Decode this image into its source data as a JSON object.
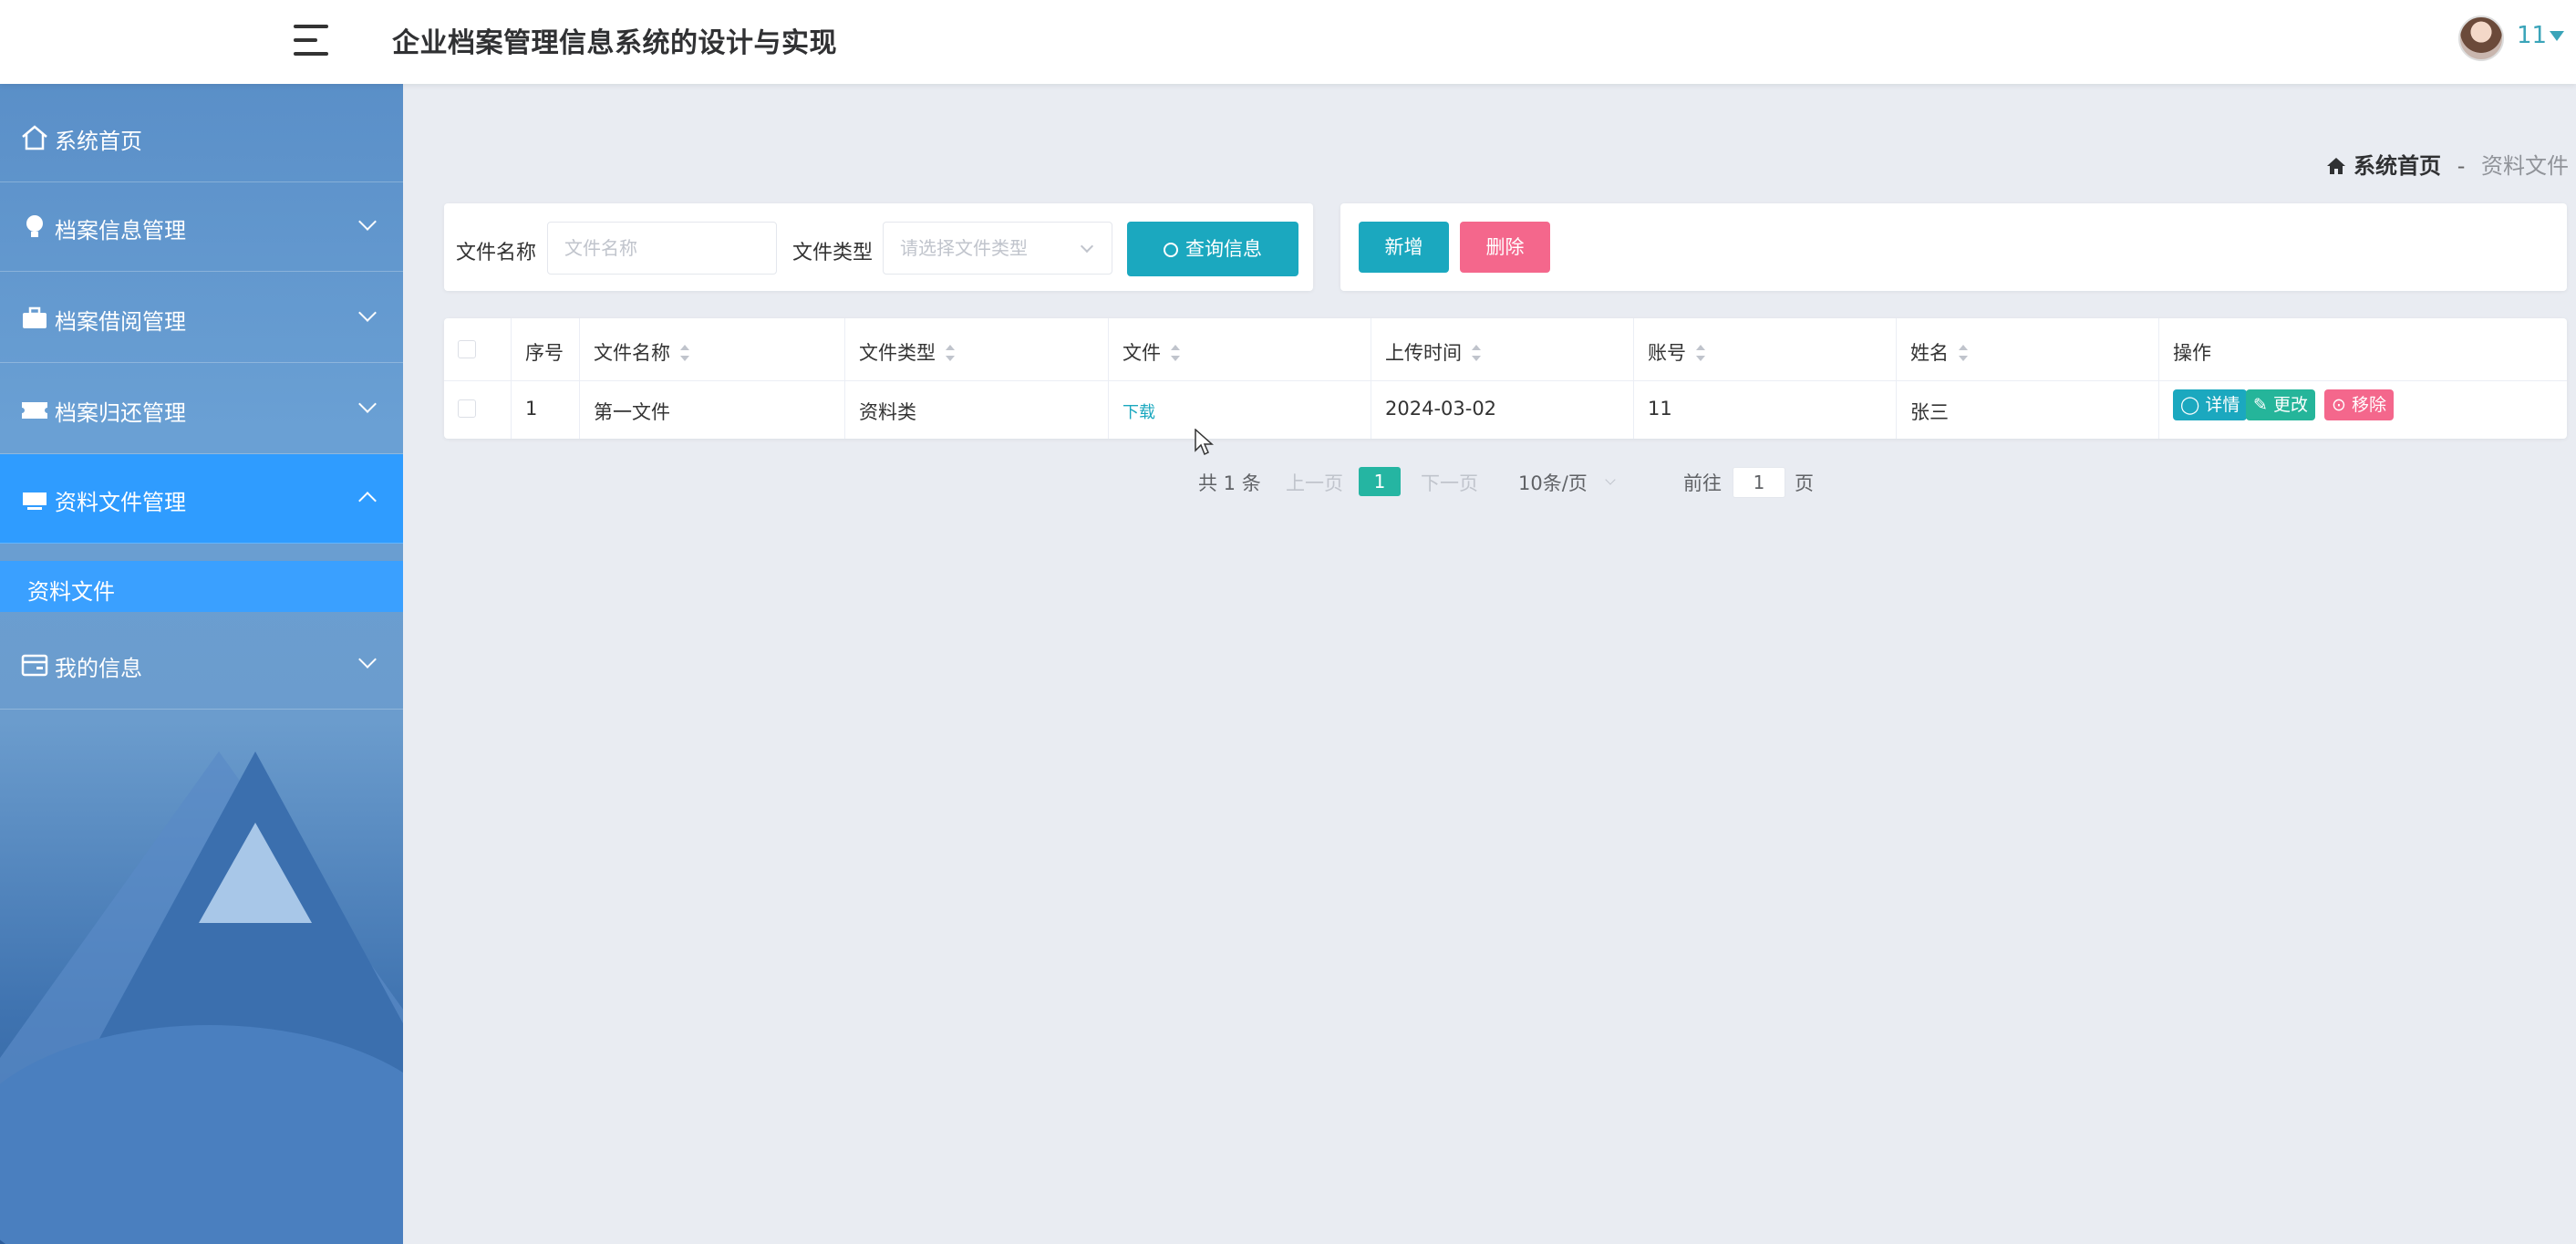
{
  "header": {
    "title": "企业档案管理信息系统的设计与实现",
    "user_name": "11"
  },
  "sidebar": {
    "items": [
      {
        "label": "系统首页",
        "icon": "home-icon"
      },
      {
        "label": "档案信息管理",
        "icon": "lightbulb-icon"
      },
      {
        "label": "档案借阅管理",
        "icon": "briefcase-icon"
      },
      {
        "label": "档案归还管理",
        "icon": "ticket-icon"
      },
      {
        "label": "资料文件管理",
        "icon": "tray-icon"
      },
      {
        "label": "我的信息",
        "icon": "card-icon"
      }
    ],
    "sub_item": "资料文件"
  },
  "breadcrumb": {
    "home": "系统首页",
    "separator": "-",
    "current": "资料文件"
  },
  "search": {
    "name_label": "文件名称",
    "name_placeholder": "文件名称",
    "type_label": "文件类型",
    "type_placeholder": "请选择文件类型",
    "query_button": "查询信息"
  },
  "actions": {
    "add_button": "新增",
    "delete_button": "删除"
  },
  "table": {
    "columns": [
      "序号",
      "文件名称",
      "文件类型",
      "文件",
      "上传时间",
      "账号",
      "姓名",
      "操作"
    ],
    "rows": [
      {
        "index": "1",
        "file_name": "第一文件",
        "file_type": "资料类",
        "file": "下载",
        "upload_time": "2024-03-02",
        "account": "11",
        "name": "张三"
      }
    ],
    "op_detail": "详情",
    "op_edit": "更改",
    "op_remove": "移除"
  },
  "pagination": {
    "total": "共 1 条",
    "prev": "上一页",
    "current_page": "1",
    "next": "下一页",
    "page_size": "10条/页",
    "goto_label": "前往",
    "goto_value": "1",
    "page_suffix": "页"
  },
  "colors": {
    "accent": "#1ba8bf",
    "danger": "#f4678c",
    "success": "#25b59a",
    "sidebar_active": "#2f9cff"
  }
}
